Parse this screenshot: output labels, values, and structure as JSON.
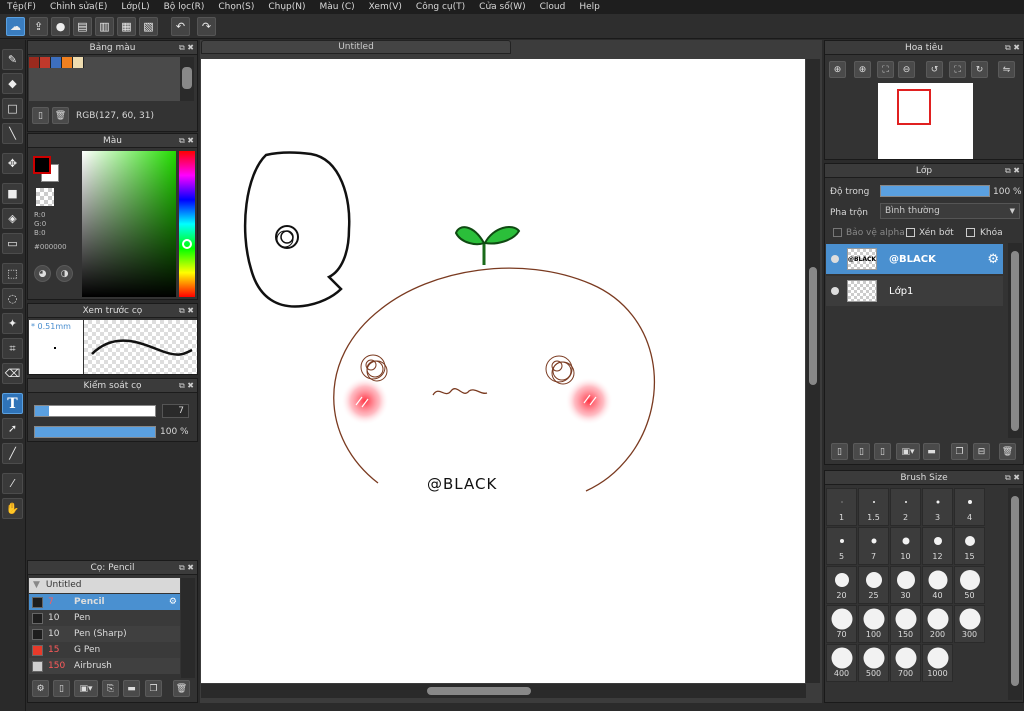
{
  "menu": [
    "Tệp(F)",
    "Chỉnh sửa(E)",
    "Lớp(L)",
    "Bộ lọc(R)",
    "Chọn(S)",
    "Chụp(N)",
    "Màu (C)",
    "Xem(V)",
    "Công cụ(T)",
    "Cửa sổ(W)",
    "Cloud",
    "Help"
  ],
  "toolbar": {
    "undo_icon": "undo-arrow",
    "redo_icon": "redo-arrow"
  },
  "document": {
    "tab_title": "Untitled"
  },
  "palette": {
    "title": "Bảng màu",
    "rgb_text": "RGB(127, 60, 31)",
    "swatches": [
      "#9a2a1e",
      "#c0392b",
      "#3d6fbf",
      "#f08020",
      "#eedcb0"
    ]
  },
  "color": {
    "title": "Màu",
    "r": "R:0",
    "g": "G:0",
    "b": "B:0",
    "hex": "#000000",
    "foreground": "#000000",
    "background": "#ffffff"
  },
  "brush_preview": {
    "title": "Xem trước cọ",
    "size_text": "* 0.51mm"
  },
  "brush_control": {
    "title": "Kiểm soát cọ",
    "size_value": "7",
    "opacity_value": "100 %",
    "size_fraction": 0.12,
    "opacity_fraction": 1.0
  },
  "brush_list": {
    "title": "Cọ: Pencil",
    "group": "Untitled",
    "items": [
      {
        "size": "7",
        "name": "Pencil",
        "color": "#1e1e1e",
        "selected": true
      },
      {
        "size": "10",
        "name": "Pen",
        "color": "#1e1e1e",
        "selected": false
      },
      {
        "size": "10",
        "name": "Pen (Sharp)",
        "color": "#1e1e1e",
        "selected": false
      },
      {
        "size": "15",
        "name": "G Pen",
        "color": "#e83a2a",
        "selected": false
      },
      {
        "size": "150",
        "name": "Airbrush",
        "color": "#cfcfcf",
        "selected": false
      }
    ]
  },
  "navigator": {
    "title": "Hoa tiêu"
  },
  "layers": {
    "title": "Lớp",
    "opacity_label": "Độ trong",
    "opacity_value": "100 %",
    "blend_label": "Pha trộn",
    "blend_value": "Bình thường",
    "protect_alpha": "Bảo vệ alpha",
    "clip": "Xén bớt",
    "lock": "Khóa",
    "items": [
      {
        "name": "@BLACK",
        "thumb_text": "@BLACK",
        "selected": true
      },
      {
        "name": "Lớp1",
        "thumb_text": "",
        "selected": false
      }
    ]
  },
  "brush_size": {
    "title": "Brush Size",
    "sizes": [
      "1",
      "1.5",
      "2",
      "3",
      "4",
      "5",
      "7",
      "10",
      "12",
      "15",
      "20",
      "25",
      "30",
      "40",
      "50",
      "70",
      "100",
      "150",
      "200",
      "300",
      "400",
      "500",
      "700",
      "1000"
    ]
  },
  "artwork": {
    "text": "@BLACK"
  }
}
